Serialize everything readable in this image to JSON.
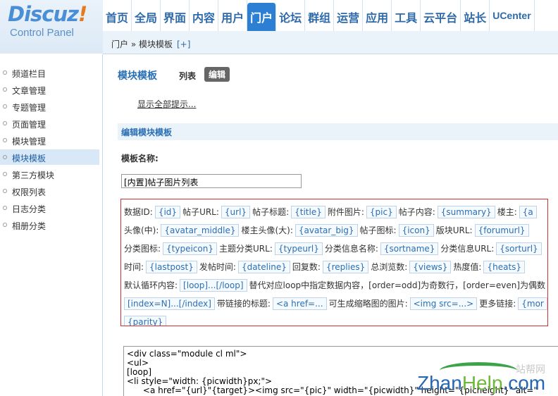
{
  "logo": {
    "brand": "Discuz",
    "bang": "!",
    "sub": "Control Panel"
  },
  "topnav": [
    "首页",
    "全局",
    "界面",
    "内容",
    "用户",
    "门户",
    "论坛",
    "群组",
    "运营",
    "应用",
    "工具",
    "云平台",
    "站长",
    "UCenter"
  ],
  "topnav_active": "门户",
  "breadcrumb": {
    "text": "门户 » 模块模板",
    "add": "[+]"
  },
  "sidebar": [
    "频道栏目",
    "文章管理",
    "专题管理",
    "页面管理",
    "模块管理",
    "模块模板",
    "第三方模块",
    "权限列表",
    "日志分类",
    "相册分类"
  ],
  "sidebar_active": "模块模板",
  "main": {
    "title": "模块模板",
    "tab_list": "列表",
    "tab_edit": "编辑",
    "show_tips": "显示全部提示...",
    "section_title": "编辑模块模板",
    "name_label": "模板名称:",
    "name_value": "[内置]帖子图片列表"
  },
  "vars": {
    "row1": {
      "l1": "数据ID:",
      "c1": "{id}",
      "l2": "帖子URL:",
      "c2": "{url}",
      "l3": "帖子标题:",
      "c3": "{title}",
      "l4": "附件图片:",
      "c4": "{pic}",
      "l5": "帖子内容:",
      "c5": "{summary}",
      "l6": "楼主:",
      "c6": "{a"
    },
    "row2": {
      "l1": "头像(中):",
      "c1": "{avatar_middle}",
      "l2": "楼主头像(大):",
      "c2": "{avatar_big}",
      "l3": "帖子图标:",
      "c3": "{icon}",
      "l4": "版块URL:",
      "c4": "{forumurl}"
    },
    "row3": {
      "l1": "分类图标:",
      "c1": "{typeicon}",
      "l2": "主题分类URL:",
      "c2": "{typeurl}",
      "l3": "分类信息名称:",
      "c3": "{sortname}",
      "l4": "分类信息URL:",
      "c4": "{sorturl}"
    },
    "row4": {
      "l1": "时间:",
      "c1": "{lastpost}",
      "l2": "发帖时间:",
      "c2": "{dateline}",
      "l3": "回复数:",
      "c3": "{replies}",
      "l4": "总浏览数:",
      "c4": "{views}",
      "l5": "热度值:",
      "c5": "{heats}"
    },
    "row5": {
      "l1": "默认循环内容:",
      "c1": "[loop]...[/loop]",
      "l2": "替代对应loop中指定数据内容，[order=odd]为奇数行，[order=even]为偶数"
    },
    "row6": {
      "c1": "[index=N]...[/index]",
      "l1": "带链接的标题:",
      "c2": "<a href=...",
      "l2": "可生成缩略图的图片:",
      "c3": "<img src=...>",
      "l3": "更多链接:",
      "c4": "{mor"
    },
    "row7": {
      "c1": "{parity}"
    }
  },
  "code": "<div class=\"module cl ml\">\n<ul>\n[loop]\n<li style=\"width: {picwidth}px;\">\n      <a href=\"{url}\"{target}><img src=\"{pic}\" width=\"{picwidth}\" height=\"{picheight}\" alt=\"",
  "watermark": {
    "cn": "站帮网",
    "en1": "Zhan",
    "en2": "Help",
    "en3": ".com"
  }
}
